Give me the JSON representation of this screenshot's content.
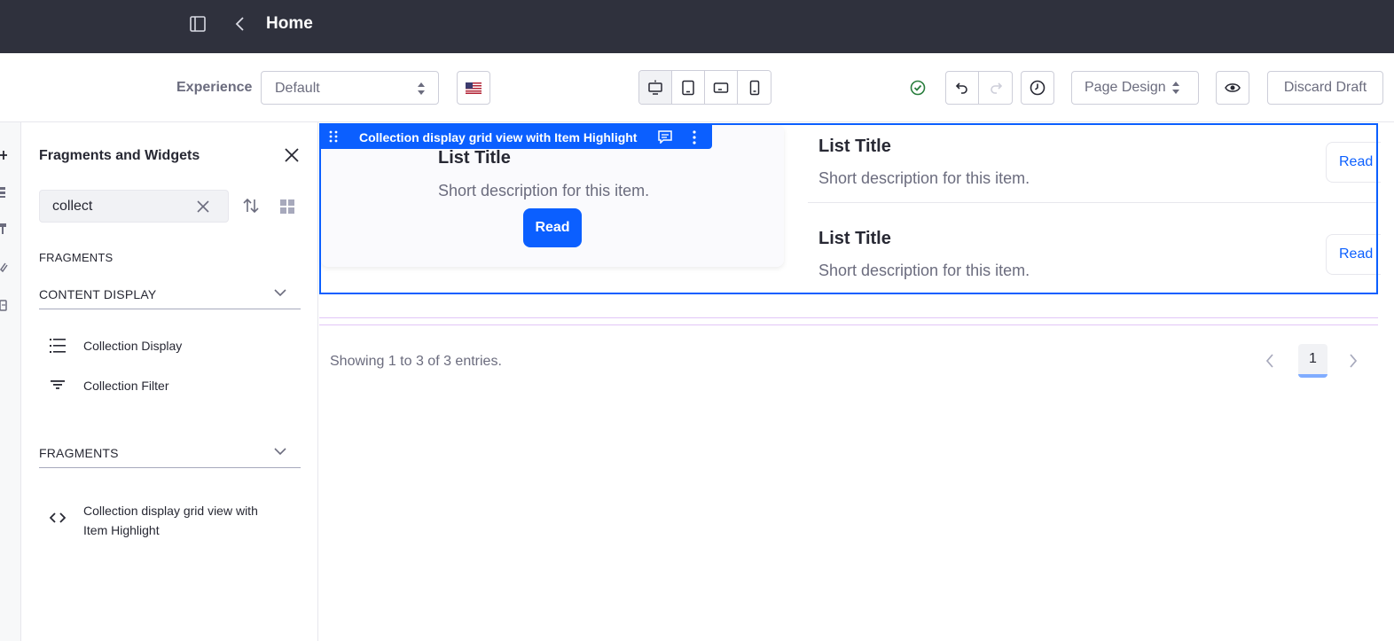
{
  "header": {
    "title": "Home"
  },
  "toolbar": {
    "experience_label": "Experience",
    "experience_value": "Default",
    "page_design_label": "Page Design",
    "discard_label": "Discard Draft",
    "icons": [
      "sidebar-toggle-icon",
      "back-icon",
      "flag-icon",
      "desktop-icon",
      "tablet-icon",
      "landscape-phone-icon",
      "portrait-phone-icon",
      "check-circle-icon",
      "undo-icon",
      "redo-icon",
      "history-icon",
      "eye-icon"
    ]
  },
  "panel": {
    "title": "Fragments and Widgets",
    "search_value": "collect",
    "section_label": "FRAGMENTS",
    "group1": {
      "label": "CONTENT DISPLAY",
      "items": [
        {
          "label": "Collection Display",
          "icon": "list-icon"
        },
        {
          "label": "Collection Filter",
          "icon": "filter-icon"
        }
      ]
    },
    "group2": {
      "label": "FRAGMENTS",
      "items": [
        {
          "label": "Collection display grid view with Item Highlight",
          "icon": "code-icon"
        }
      ]
    }
  },
  "canvas": {
    "fragment_bar_name": "Collection display grid view with Item Highlight",
    "card": {
      "title": "List Title",
      "description": "Short description for this item.",
      "button": "Read"
    },
    "list_items": [
      {
        "title": "List Title",
        "description": "Short description for this item.",
        "button": "Read"
      },
      {
        "title": "List Title",
        "description": "Short description for this item.",
        "button": "Read"
      }
    ],
    "showing_text": "Showing 1 to 3 of 3 entries.",
    "current_page": "1"
  },
  "colors": {
    "primary": "#0b5fff",
    "topbar": "#2f313d",
    "success": "#287d3c",
    "text_secondary": "#6b6c7e"
  }
}
